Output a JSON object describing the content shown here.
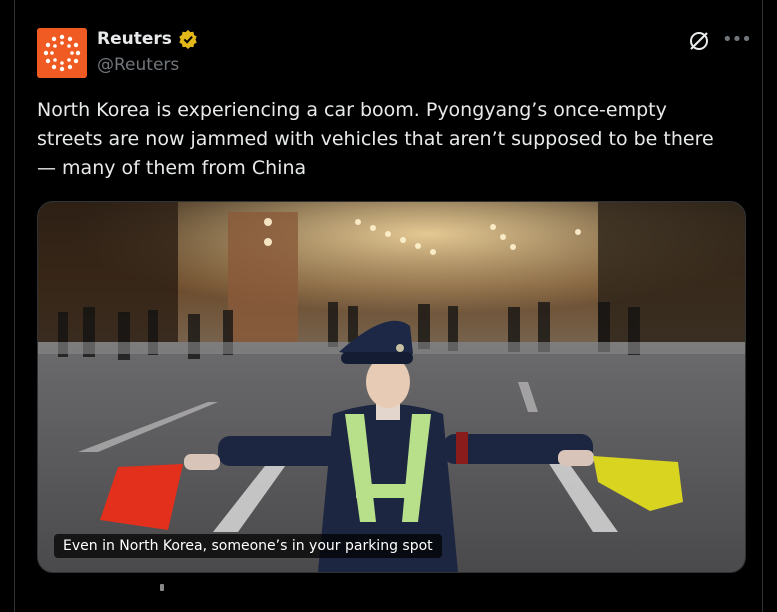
{
  "author": {
    "name": "Reuters",
    "handle": "@Reuters",
    "verified": true,
    "brand_color": "#ef5b22",
    "badge_color": "#e2b719"
  },
  "actions": {
    "grok_icon": "grok-icon",
    "more_icon": "more-icon"
  },
  "tweet": {
    "text": "North Korea is experiencing a car boom. Pyongyang’s once-empty streets are now jammed with vehicles that aren’t supposed to be there — many of them from China"
  },
  "media": {
    "caption": "Even in North Korea, someone’s in your parking spot"
  }
}
